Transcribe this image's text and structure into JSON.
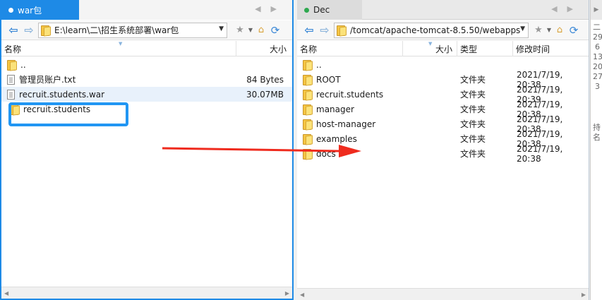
{
  "left": {
    "tab_label": "war包",
    "path": "E:\\learn\\二\\招生系统部署\\war包",
    "columns": {
      "name": "名称",
      "size": "大小"
    },
    "files": [
      {
        "name": "..",
        "size": "",
        "icon": "folder-icon"
      },
      {
        "name": "管理员账户.txt",
        "size": "84 Bytes",
        "icon": "file-icon"
      },
      {
        "name": "recruit.students.war",
        "size": "30.07MB",
        "icon": "file-icon"
      },
      {
        "name": "recruit.students",
        "size": "",
        "icon": "folder-icon"
      }
    ]
  },
  "right": {
    "tab_label": "Dec",
    "path": "/tomcat/apache-tomcat-8.5.50/webapps",
    "columns": {
      "name": "名称",
      "size": "大小",
      "type": "类型",
      "mtime": "修改时间"
    },
    "files": [
      {
        "name": "..",
        "type": "",
        "mtime": ""
      },
      {
        "name": "ROOT",
        "type": "文件夹",
        "mtime": "2021/7/19, 20:38"
      },
      {
        "name": "recruit.students",
        "type": "文件夹",
        "mtime": "2021/7/19, 20:39"
      },
      {
        "name": "manager",
        "type": "文件夹",
        "mtime": "2021/7/19, 20:38"
      },
      {
        "name": "host-manager",
        "type": "文件夹",
        "mtime": "2021/7/19, 20:38"
      },
      {
        "name": "examples",
        "type": "文件夹",
        "mtime": "2021/7/19, 20:38"
      },
      {
        "name": "docs",
        "type": "文件夹",
        "mtime": "2021/7/19, 20:38"
      }
    ]
  },
  "edge_fragments": [
    "二",
    "29",
    "6",
    "13",
    "20",
    "27",
    "3",
    "持",
    "名"
  ],
  "colors": {
    "accent": "#1e8ae6",
    "highlight": "#2196f3",
    "arrow": "#ef2b1e",
    "folder": "#f5c542"
  }
}
